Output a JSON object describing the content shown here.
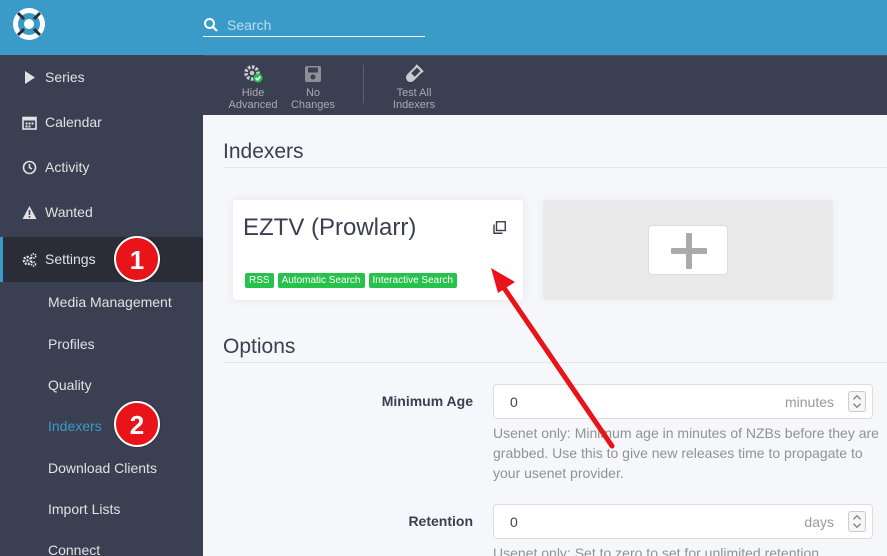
{
  "header": {
    "search_placeholder": "Search"
  },
  "sidebar": {
    "items": [
      {
        "label": "Series",
        "icon": "play-icon"
      },
      {
        "label": "Calendar",
        "icon": "calendar-icon"
      },
      {
        "label": "Activity",
        "icon": "clock-icon"
      },
      {
        "label": "Wanted",
        "icon": "warning-icon"
      },
      {
        "label": "Settings",
        "icon": "gears-icon"
      }
    ],
    "sub_items": [
      {
        "label": "Media Management"
      },
      {
        "label": "Profiles"
      },
      {
        "label": "Quality"
      },
      {
        "label": "Indexers"
      },
      {
        "label": "Download Clients"
      },
      {
        "label": "Import Lists"
      },
      {
        "label": "Connect"
      }
    ]
  },
  "markers": {
    "one": "1",
    "two": "2"
  },
  "toolbar": {
    "hide_advanced": "Hide Advanced",
    "no_changes": "No Changes",
    "test_all": "Test All Indexers"
  },
  "main": {
    "indexers_title": "Indexers",
    "options_title": "Options",
    "indexer_card": {
      "name": "EZTV (Prowlarr)",
      "tags": [
        "RSS",
        "Automatic Search",
        "Interactive Search"
      ]
    },
    "fields": {
      "minimum_age": {
        "label": "Minimum Age",
        "value": "0",
        "unit": "minutes",
        "help": "Usenet only: Minimum age in minutes of NZBs before they are grabbed. Use this to give new releases time to propagate to your usenet provider."
      },
      "retention": {
        "label": "Retention",
        "value": "0",
        "unit": "days",
        "help": "Usenet only: Set to zero to set for unlimited retention"
      }
    }
  },
  "colors": {
    "header": "#3a9bc8",
    "sidebar": "#3a3f51",
    "active_link": "#3a9bc8",
    "tag_green": "#27c24c",
    "marker_red": "#e8141a"
  }
}
